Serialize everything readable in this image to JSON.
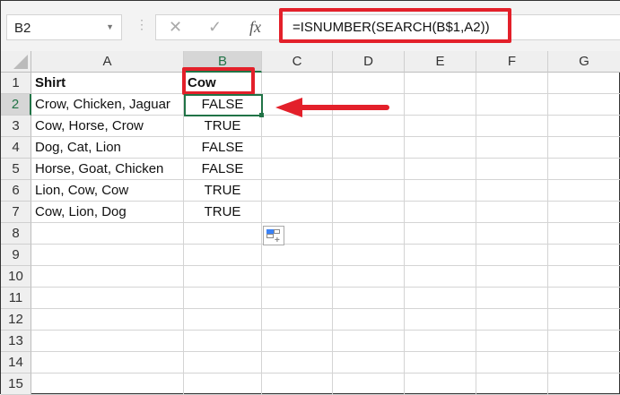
{
  "name_box": "B2",
  "formula_bar": {
    "fx_label": "fx",
    "cancel": "✕",
    "enter": "✓",
    "formula": "=ISNUMBER(SEARCH(B$1,A2))"
  },
  "columns": [
    "A",
    "B",
    "C",
    "D",
    "E",
    "F",
    "G"
  ],
  "rows": [
    "1",
    "2",
    "3",
    "4",
    "5",
    "6",
    "7",
    "8",
    "9",
    "10",
    "11",
    "12",
    "13",
    "14",
    "15"
  ],
  "cells": {
    "A": [
      "Shirt",
      "Crow, Chicken, Jaguar",
      "Cow, Horse, Crow",
      "Dog, Cat, Lion",
      "Horse, Goat, Chicken",
      "Lion, Cow, Cow",
      "Cow, Lion, Dog"
    ],
    "B": [
      "Cow",
      "FALSE",
      "TRUE",
      "FALSE",
      "FALSE",
      "TRUE",
      "TRUE"
    ]
  },
  "selected_cell": "B2",
  "accent_color": "#e3202a"
}
